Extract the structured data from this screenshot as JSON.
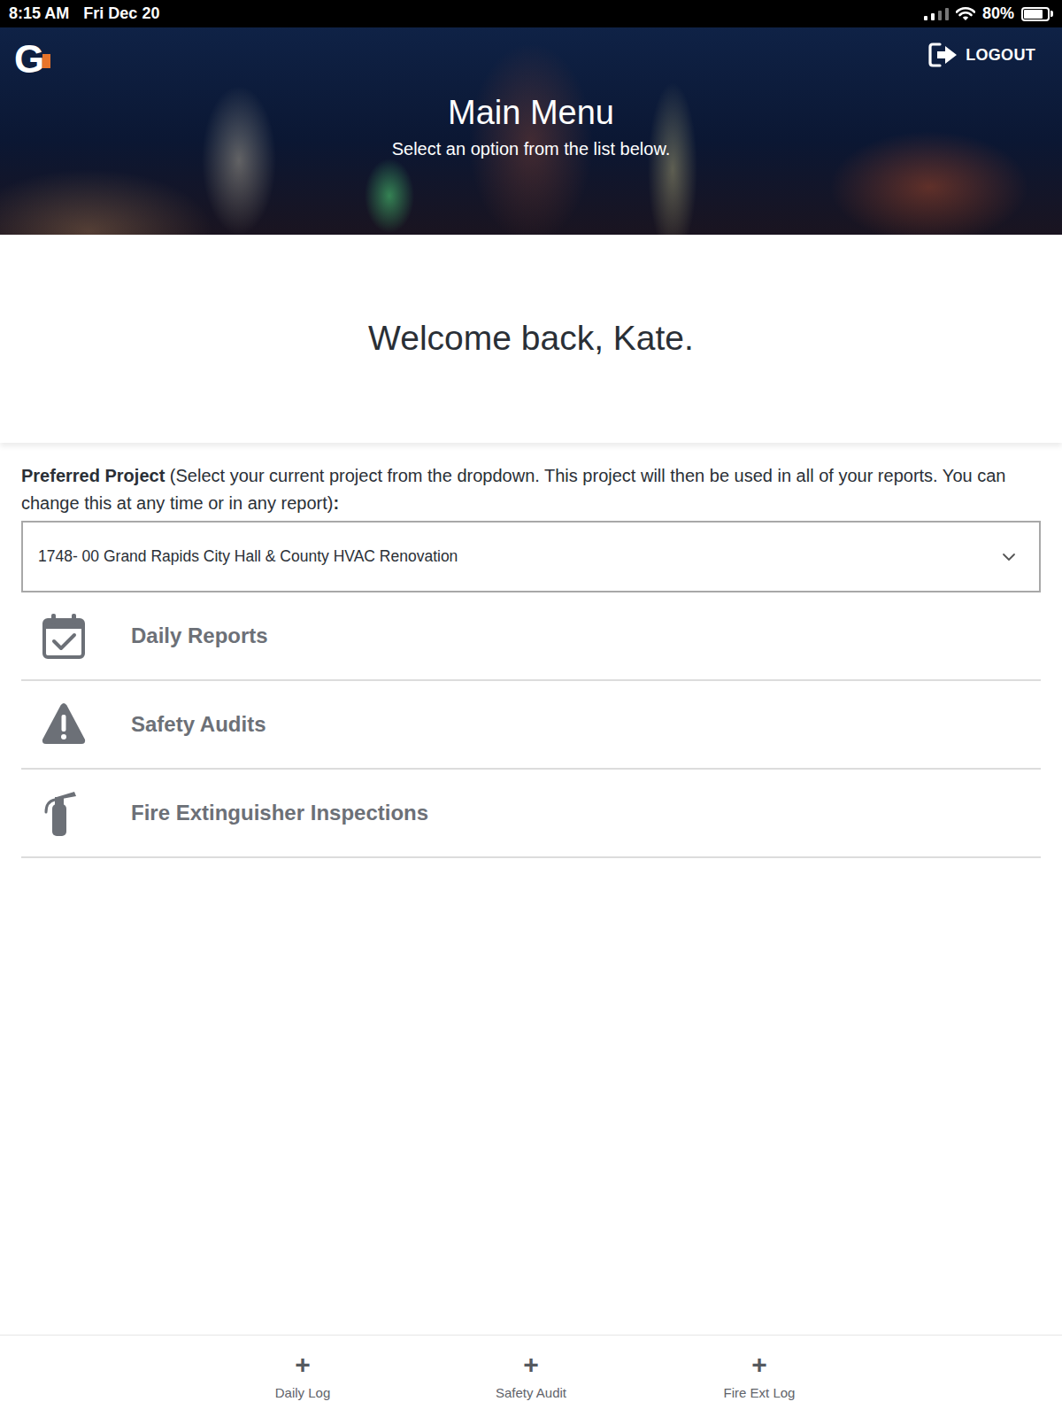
{
  "status_bar": {
    "time": "8:15 AM",
    "date": "Fri Dec 20",
    "battery": "80%",
    "battery_level": 0.8,
    "signal_level": 0.5
  },
  "header": {
    "logo": "G",
    "logout": "LOGOUT",
    "title": "Main Menu",
    "subtitle": "Select an option from the list below."
  },
  "welcome": "Welcome back, Kate.",
  "preferred_project": {
    "label": "Preferred Project",
    "hint": " (Select your current project from the dropdown. This project will then be used in all of your reports. You can change this at any time or in any report)",
    "colon": ":",
    "value": "1748- 00 Grand Rapids City Hall & County HVAC Renovation"
  },
  "menu": [
    {
      "label": "Daily Reports",
      "kind": "calendar"
    },
    {
      "label": "Safety Audits",
      "kind": "warning"
    },
    {
      "label": "Fire Extinguisher Inspections",
      "kind": "extinguisher"
    }
  ],
  "bottom_bar": [
    {
      "icon": "+",
      "label": "Daily Log"
    },
    {
      "icon": "+",
      "label": "Safety Audit"
    },
    {
      "icon": "+",
      "label": "Fire Ext Log"
    }
  ]
}
